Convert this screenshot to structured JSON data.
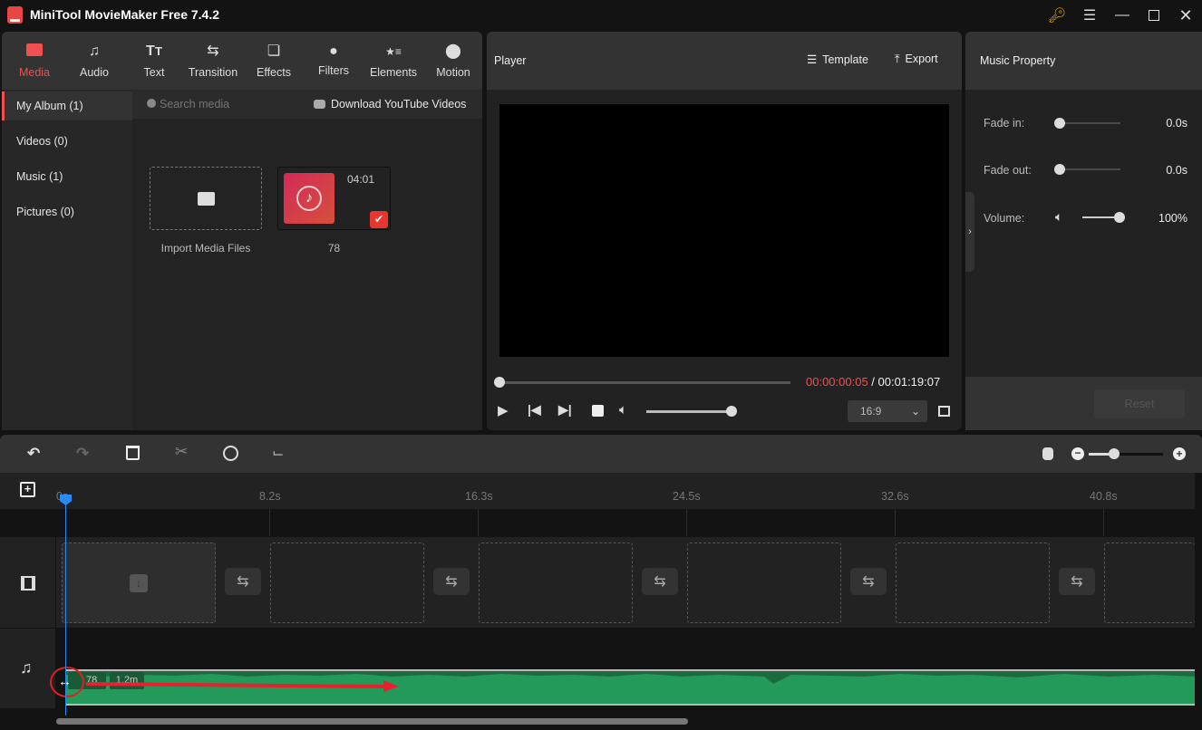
{
  "window": {
    "title": "MiniTool MovieMaker Free 7.4.2",
    "controls": [
      "key-icon",
      "menu-icon",
      "minimize-icon",
      "maximize-icon",
      "close-icon"
    ]
  },
  "toolbar": {
    "tabs": [
      {
        "label": "Media",
        "icon": "folder-icon",
        "active": true
      },
      {
        "label": "Audio",
        "icon": "music-note-icon"
      },
      {
        "label": "Text",
        "icon": "text-icon"
      },
      {
        "label": "Transition",
        "icon": "transition-icon"
      },
      {
        "label": "Effects",
        "icon": "effects-icon"
      },
      {
        "label": "Filters",
        "icon": "filters-icon"
      },
      {
        "label": "Elements",
        "icon": "elements-icon"
      },
      {
        "label": "Motion",
        "icon": "motion-icon"
      }
    ],
    "accent_color": "#f05050"
  },
  "album": {
    "items": [
      {
        "label": "My Album (1)",
        "active": true
      },
      {
        "label": "Videos (0)"
      },
      {
        "label": "Music (1)"
      },
      {
        "label": "Pictures (0)"
      }
    ]
  },
  "media": {
    "search_placeholder": "Search media",
    "download_label": "Download YouTube Videos",
    "import_label": "Import Media Files",
    "items": [
      {
        "name": "78",
        "duration": "04:01",
        "type": "music",
        "selected": true
      }
    ]
  },
  "player": {
    "title": "Player",
    "template_label": "Template",
    "export_label": "Export",
    "current_time": "00:00:00:05",
    "separator": " / ",
    "total_time": "00:01:19:07",
    "aspect_ratio": "16:9",
    "progress": 0.0,
    "volume_level": 1.0
  },
  "property": {
    "title": "Music Property",
    "fade_in_label": "Fade in:",
    "fade_in_value": "0.0s",
    "fade_out_label": "Fade out:",
    "fade_out_value": "0.0s",
    "volume_label": "Volume:",
    "volume_value": "100%",
    "reset_label": "Reset"
  },
  "timeline": {
    "toolbar": [
      "undo-icon",
      "redo-icon",
      "delete-icon",
      "split-icon",
      "speed-icon",
      "crop-icon"
    ],
    "zoom_level": 0.3,
    "ruler": [
      "0s",
      "8.2s",
      "16.3s",
      "24.5s",
      "32.6s",
      "40.8s"
    ],
    "audio_clip": {
      "name": "78",
      "duration": "1.2m"
    },
    "playhead_color": "#2a8bf2",
    "audio_color": "#249a5a"
  }
}
